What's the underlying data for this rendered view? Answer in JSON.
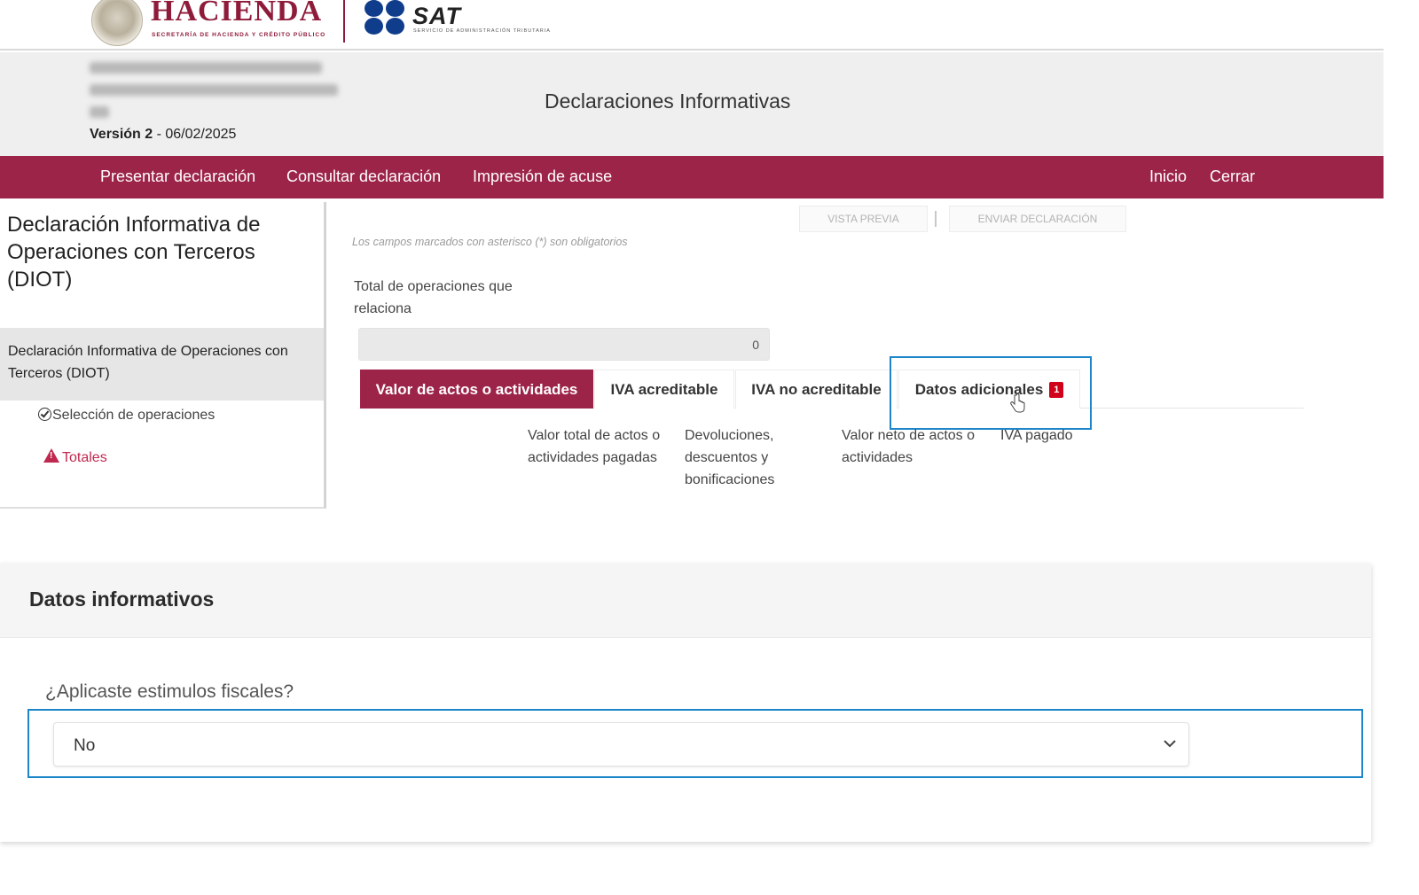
{
  "brand": {
    "hacienda": "HACIENDA",
    "hacienda_sub": "SECRETARÍA DE HACIENDA Y CRÉDITO PÚBLICO",
    "sat": "SAT",
    "sat_sub": "SERVICIO DE ADMINISTRACIÓN TRIBUTARIA",
    "maroon": "#9d2449",
    "blue": "#0f3d8c"
  },
  "header": {
    "version_label": "Versión 2",
    "version_date": " - 06/02/2025",
    "app_title": "Declaraciones Informativas"
  },
  "nav": {
    "items": [
      "Presentar declaración",
      "Consultar declaración",
      "Impresión de acuse"
    ],
    "right_items": [
      "Inicio",
      "Cerrar"
    ]
  },
  "sidebar": {
    "title": "Declaración Informativa de Operaciones con Terceros (DIOT)",
    "selected": "Declaración Informativa de Operaciones con Terceros (DIOT)",
    "links": [
      "Selección de operaciones",
      "Totales"
    ]
  },
  "toolbar": {
    "preview": "VISTA PREVIA",
    "send": "ENVIAR DECLARACIÓN"
  },
  "form": {
    "mandatory_note": "Los campos marcados con asterisco (*) son obligatorios",
    "total_label": "Total de operaciones que relaciona",
    "total_value": "0"
  },
  "tabs": {
    "items": [
      "Valor de actos o actividades",
      "IVA acreditable",
      "IVA no acreditable",
      "Datos adicionales"
    ],
    "badge": "1",
    "active_index": 0
  },
  "columns": [
    "Valor total de actos o actividades pagadas",
    "Devoluciones, descuentos y bonificaciones",
    "Valor neto de actos o actividades",
    "IVA pagado"
  ],
  "panel": {
    "title": "Datos informativos",
    "question": "¿Aplicaste estimulos fiscales?",
    "selected_value": "No"
  },
  "highlight_color": "#1d86c9"
}
